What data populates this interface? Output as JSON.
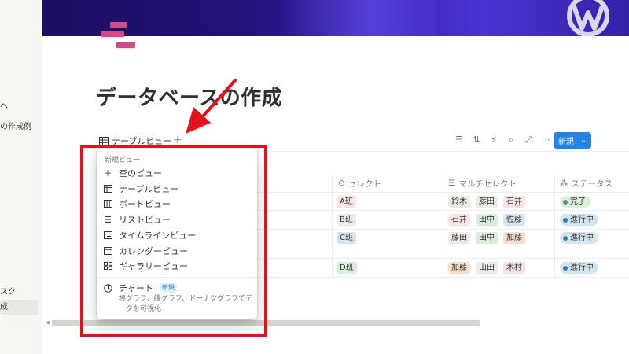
{
  "sidebar": {
    "items": [
      {
        "label": "へ"
      },
      {
        "label": "の作成例"
      },
      {
        "label": "スク"
      },
      {
        "label": "成"
      }
    ]
  },
  "page": {
    "title": "データベースの作成"
  },
  "view_bar": {
    "view_label": "テーブルビュー",
    "add_view": "+",
    "new_button_label": "新規"
  },
  "table": {
    "columns": [
      {
        "label": "セレクト"
      },
      {
        "label": "マルチセレクト"
      },
      {
        "label": "ステータス"
      }
    ],
    "rows": [
      {
        "select": "A班",
        "multi": [
          "鈴木",
          "藤田",
          "石井"
        ],
        "status": "完了"
      },
      {
        "select": "B班",
        "multi": [
          "石井",
          "田中",
          "佐藤"
        ],
        "status": "進行中"
      },
      {
        "select": "C班",
        "multi": [
          "藤田",
          "田中",
          "加藤"
        ],
        "status": "進行中"
      },
      {
        "select": "D班",
        "multi": [
          "加藤",
          "山田",
          "木村"
        ],
        "status": "進行中"
      }
    ]
  },
  "menu": {
    "header": "新規ビュー",
    "items": [
      {
        "label": "空のビュー",
        "icon": "plus-icon"
      },
      {
        "label": "テーブルビュー",
        "icon": "table-icon"
      },
      {
        "label": "ボードビュー",
        "icon": "board-icon"
      },
      {
        "label": "リストビュー",
        "icon": "list-icon"
      },
      {
        "label": "タイムラインビュー",
        "icon": "timeline-icon"
      },
      {
        "label": "カレンダービュー",
        "icon": "calendar-icon"
      },
      {
        "label": "ギャラリービュー",
        "icon": "gallery-icon"
      }
    ],
    "chart": {
      "label": "チャート",
      "badge": "新規",
      "description": "棒グラフ、線グラフ、ドーナツグラフでデータを可視化"
    }
  },
  "colors": {
    "accent": "#2383e2",
    "highlight_red": "#e8101b",
    "icon_pink": "#cf4a87"
  }
}
